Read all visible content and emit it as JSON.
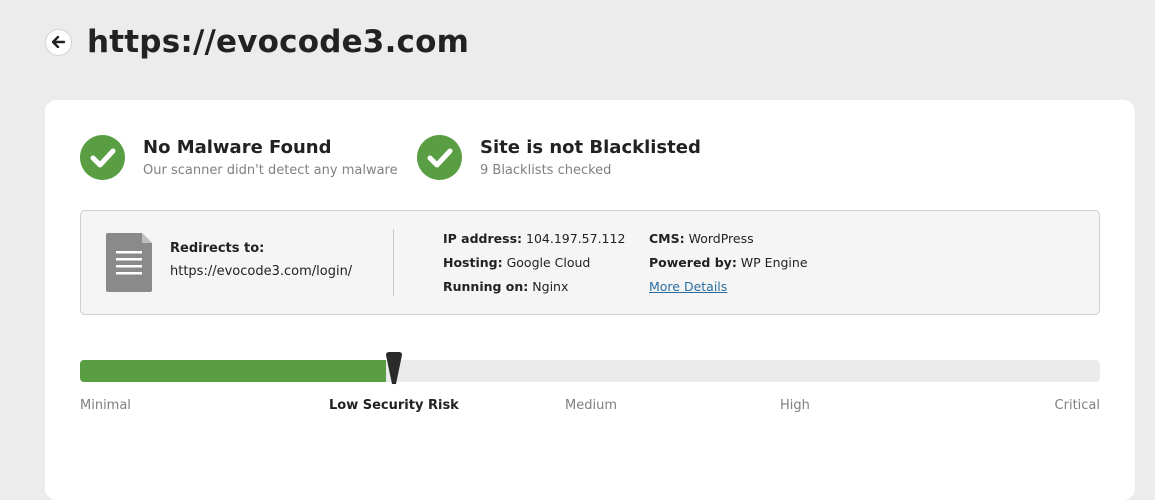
{
  "header": {
    "title": "https://evocode3.com",
    "back_icon": "arrow-left-icon"
  },
  "status": {
    "malware": {
      "title": "No Malware Found",
      "subtitle": "Our scanner didn't detect any malware",
      "icon": "check-circle-icon",
      "color": "#5a9e43"
    },
    "blacklist": {
      "title": "Site is not Blacklisted",
      "subtitle": "9 Blacklists checked",
      "icon": "check-circle-icon",
      "color": "#5a9e43"
    }
  },
  "info": {
    "icon": "document-icon",
    "redirects_label": "Redirects to:",
    "redirects_value": "https://evocode3.com/login/",
    "ip_label": "IP address:",
    "ip_value": "104.197.57.112",
    "hosting_label": "Hosting:",
    "hosting_value": "Google Cloud",
    "running_label": "Running on:",
    "running_value": "Nginx",
    "cms_label": "CMS:",
    "cms_value": "WordPress",
    "powered_label": "Powered by:",
    "powered_value": "WP Engine",
    "more_details": "More Details"
  },
  "risk": {
    "level_fraction": 0.3,
    "fill_color": "#5a9e43",
    "current": "Low Security Risk",
    "levels": {
      "minimal": "Minimal",
      "low": "Low Security Risk",
      "medium": "Medium",
      "high": "High",
      "critical": "Critical"
    }
  }
}
